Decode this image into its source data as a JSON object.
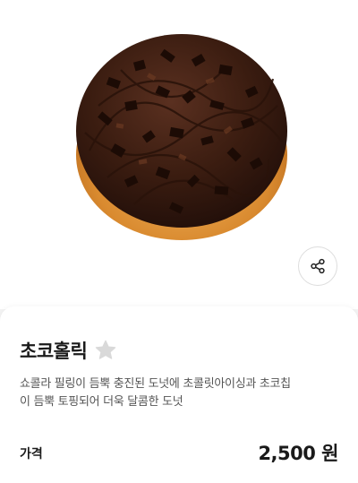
{
  "product": {
    "image_alt": "",
    "name": "초코홀릭",
    "description_line1": "쇼콜라 필링이 듬뿍 충진된 도넛에 초콜릿아이싱과 초코칩",
    "description_line2": "이 듬뿍 토핑되어 더욱 달콤한 도넛",
    "price_label": "가격",
    "price_value": "2,500 원"
  },
  "icons": {
    "share": "share-icon",
    "favorite": "star-icon"
  },
  "colors": {
    "favorite_star": "#d9d9d9",
    "text_primary": "#1a1a1a",
    "text_secondary": "#555555"
  }
}
